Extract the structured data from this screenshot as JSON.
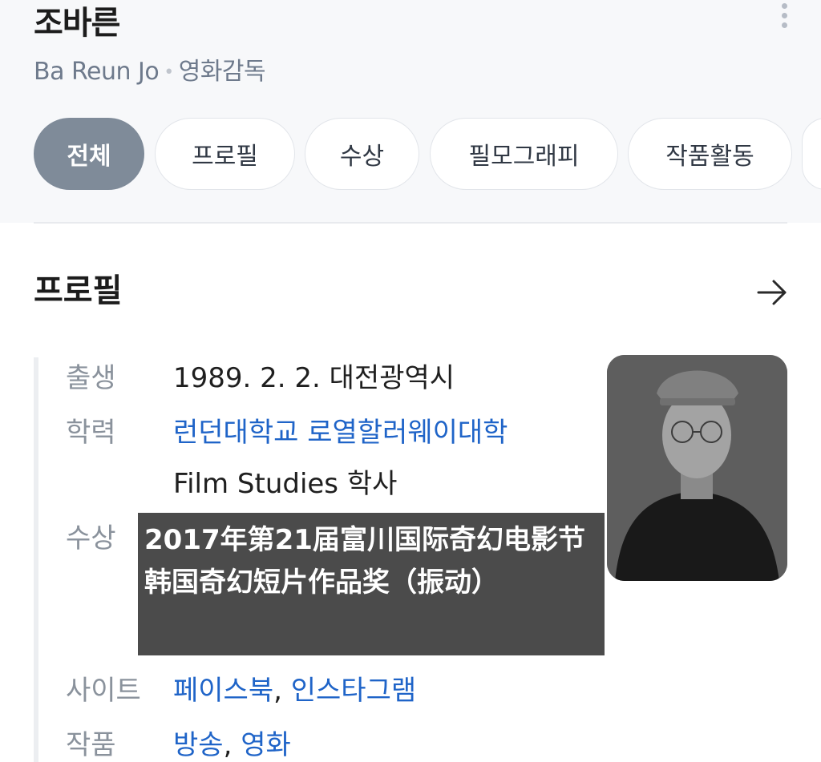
{
  "header": {
    "name": "조바른",
    "romanized": "Ba Reun Jo",
    "separator": "•",
    "occupation": "영화감독"
  },
  "tabs": [
    {
      "label": "전체",
      "active": true
    },
    {
      "label": "프로필",
      "active": false
    },
    {
      "label": "수상",
      "active": false
    },
    {
      "label": "필모그래피",
      "active": false
    },
    {
      "label": "작품활동",
      "active": false
    }
  ],
  "profile": {
    "title": "프로필",
    "birth_label": "출생",
    "birth_value": "1989. 2. 2. 대전광역시",
    "education_label": "학력",
    "education_school": "런던대학교 로열할러웨이대학",
    "education_degree": "Film Studies 학사",
    "awards_label": "수상",
    "site_label": "사이트",
    "site_facebook": "페이스북",
    "site_comma": ",",
    "site_instagram": "인스타그램",
    "works_label": "작품",
    "works_broadcast": "방송",
    "works_comma": ",",
    "works_film": "영화"
  },
  "overlay_caption": "2017年第21届富川国际奇幻电影节韩国奇幻短片作品奖（振动）",
  "icons": {
    "more": "more-vertical-icon",
    "arrow": "arrow-right-icon"
  },
  "colors": {
    "link": "#1f64c8",
    "active_tab": "#7f8b99",
    "label": "#8a929c"
  }
}
